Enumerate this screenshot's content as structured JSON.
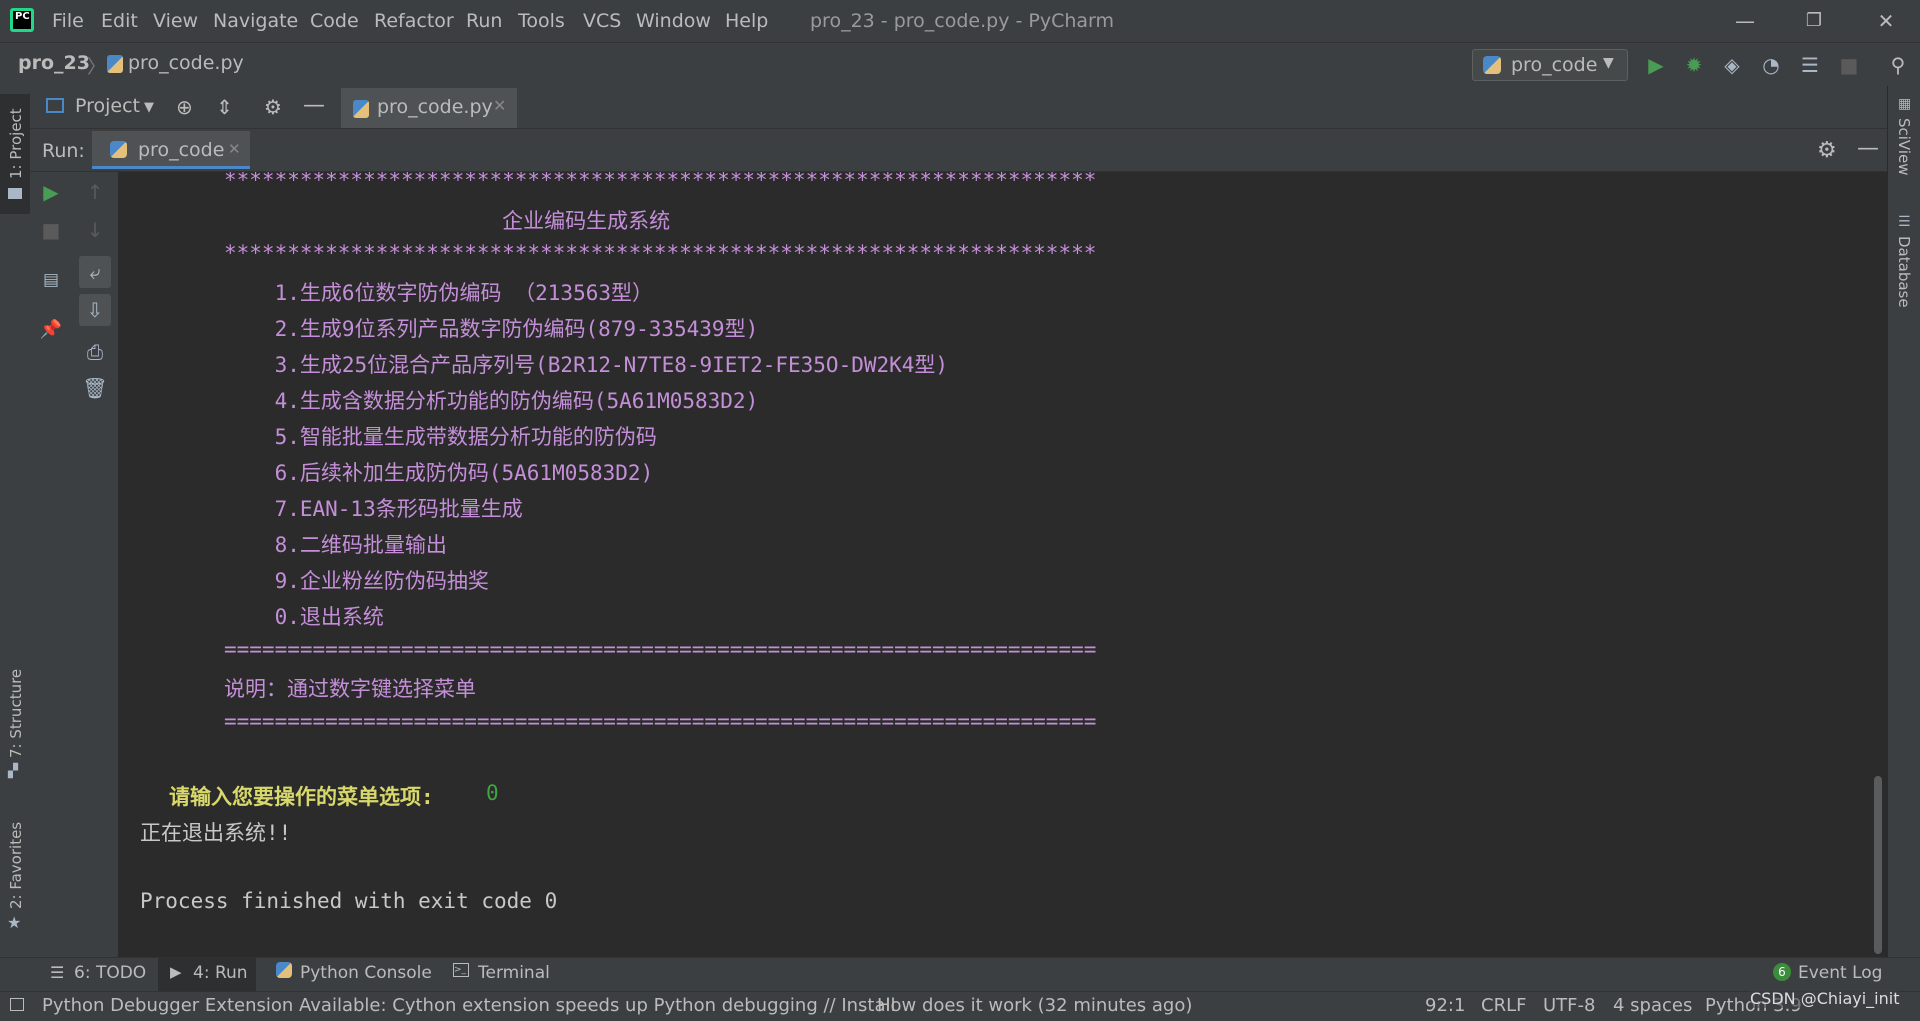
{
  "titlebar": {
    "menus": [
      "File",
      "Edit",
      "View",
      "Navigate",
      "Code",
      "Refactor",
      "Run",
      "Tools",
      "VCS",
      "Window",
      "Help"
    ],
    "window_title": "pro_23 - pro_code.py - PyCharm",
    "minimize": "—",
    "restore": "❐",
    "close": "✕"
  },
  "navbar": {
    "project": "pro_23",
    "file": "pro_code.py",
    "run_config": "pro_code"
  },
  "left_strip": {
    "project_tab": "1: Project",
    "structure_tab": "7: Structure",
    "favorites_tab": "2: Favorites"
  },
  "right_strip": {
    "sciview_tab": "SciView",
    "database_tab": "Database"
  },
  "project_toolbar": {
    "project_label": "Project",
    "editor_tab": "pro_code.py"
  },
  "run_panel": {
    "label": "Run:",
    "tab": "pro_code"
  },
  "console": {
    "lines": [
      {
        "text": "*********************************************************************",
        "cls": "purple"
      },
      {
        "text": "                      企业编码生成系统",
        "cls": "purple"
      },
      {
        "text": "*********************************************************************",
        "cls": "purple"
      },
      {
        "text": "    1.生成6位数字防伪编码 （213563型）",
        "cls": "purple"
      },
      {
        "text": "    2.生成9位系列产品数字防伪编码(879-335439型)",
        "cls": "purple"
      },
      {
        "text": "    3.生成25位混合产品序列号(B2R12-N7TE8-9IET2-FE35O-DW2K4型)",
        "cls": "purple"
      },
      {
        "text": "    4.生成含数据分析功能的防伪编码(5A61M0583D2)",
        "cls": "purple"
      },
      {
        "text": "    5.智能批量生成带数据分析功能的防伪码",
        "cls": "purple"
      },
      {
        "text": "    6.后续补加生成防伪码(5A61M0583D2)",
        "cls": "purple"
      },
      {
        "text": "    7.EAN-13条形码批量生成",
        "cls": "purple"
      },
      {
        "text": "    8.二维码批量输出",
        "cls": "purple"
      },
      {
        "text": "    9.企业粉丝防伪码抽奖",
        "cls": "purple"
      },
      {
        "text": "    0.退出系统",
        "cls": "purple"
      },
      {
        "text": "=====================================================================",
        "cls": "purple"
      },
      {
        "text": "说明：通过数字键选择菜单",
        "cls": "purple"
      },
      {
        "text": "=====================================================================",
        "cls": "purple"
      }
    ],
    "prompt": "请输入您要操作的菜单选项:",
    "input_value": "0",
    "exit_message": "正在退出系统!!",
    "process_finished": "Process finished with exit code 0"
  },
  "bottom_tabs": {
    "todo": "6: TODO",
    "run": "4: Run",
    "python_console": "Python Console",
    "terminal": "Terminal",
    "event_log": "Event Log",
    "event_badge": "6"
  },
  "statusbar": {
    "message": "Python Debugger Extension Available: Cython extension speeds up Python debugging // Install",
    "link": "How does it work (32 minutes ago)",
    "position": "92:1",
    "line_sep": "CRLF",
    "encoding": "UTF-8",
    "indent": "4 spaces",
    "interpreter": "Python 3.9",
    "watermark": "CSDN @Chiayi_init"
  }
}
